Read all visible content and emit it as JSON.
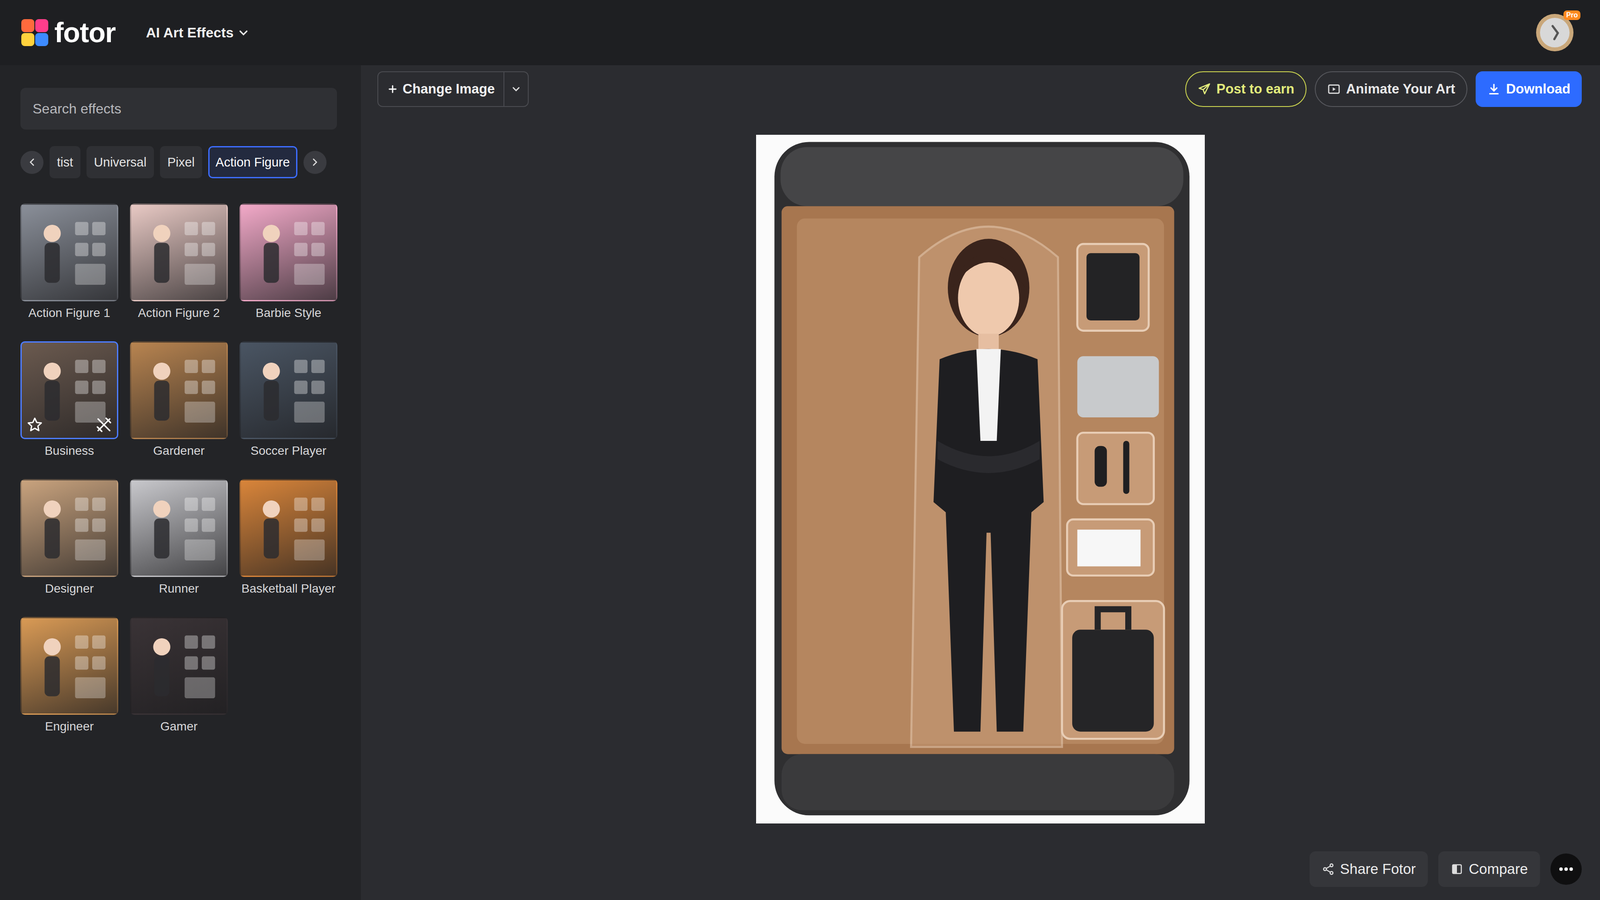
{
  "app": {
    "logo": "fotor",
    "menu": "AI Art Effects",
    "badge": "Pro"
  },
  "search": {
    "placeholder": "Search effects"
  },
  "categories": [
    {
      "label": "tist",
      "selected": false
    },
    {
      "label": "Universal",
      "selected": false
    },
    {
      "label": "Pixel",
      "selected": false
    },
    {
      "label": "Action Figure",
      "selected": true
    }
  ],
  "effects": [
    {
      "name": "Action Figure 1",
      "selected": false,
      "color": "#8a8f99"
    },
    {
      "name": "Action Figure 2",
      "selected": false,
      "color": "#e8c9c4"
    },
    {
      "name": "Barbie Style",
      "selected": false,
      "color": "#f2a9c8"
    },
    {
      "name": "Business",
      "selected": true,
      "color": "#6b5a4f"
    },
    {
      "name": "Gardener",
      "selected": false,
      "color": "#b88450"
    },
    {
      "name": "Soccer Player",
      "selected": false,
      "color": "#4a5563"
    },
    {
      "name": "Designer",
      "selected": false,
      "color": "#c9a37e"
    },
    {
      "name": "Runner",
      "selected": false,
      "color": "#c8c8cc"
    },
    {
      "name": "Basketball Player",
      "selected": false,
      "color": "#d9853a"
    },
    {
      "name": "Engineer",
      "selected": false,
      "color": "#d99a55"
    },
    {
      "name": "Gamer",
      "selected": false,
      "color": "#3a3336"
    }
  ],
  "toolbar": {
    "change_image": "Change Image",
    "post": "Post to earn",
    "animate": "Animate Your Art",
    "download": "Download"
  },
  "footer": {
    "share": "Share Fotor",
    "compare": "Compare"
  }
}
